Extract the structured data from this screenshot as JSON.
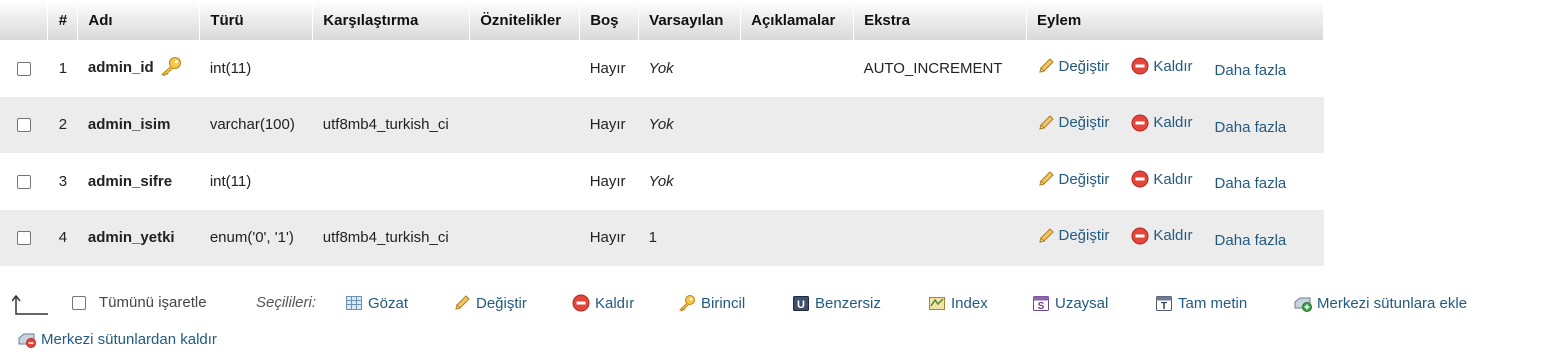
{
  "table": {
    "headers": {
      "num": "#",
      "name": "Adı",
      "type": "Türü",
      "collation": "Karşılaştırma",
      "attributes": "Öznitelikler",
      "null": "Boş",
      "default": "Varsayılan",
      "comments": "Açıklamalar",
      "extra": "Ekstra",
      "action": "Eylem"
    },
    "rows": [
      {
        "num": "1",
        "name": "admin_id",
        "type": "int(11)",
        "collation": "",
        "attributes": "",
        "null": "Hayır",
        "default": "Yok",
        "comments": "",
        "extra": "AUTO_INCREMENT",
        "primary_key": true
      },
      {
        "num": "2",
        "name": "admin_isim",
        "type": "varchar(100)",
        "collation": "utf8mb4_turkish_ci",
        "attributes": "",
        "null": "Hayır",
        "default": "Yok",
        "comments": "",
        "extra": ""
      },
      {
        "num": "3",
        "name": "admin_sifre",
        "type": "int(11)",
        "collation": "",
        "attributes": "",
        "null": "Hayır",
        "default": "Yok",
        "comments": "",
        "extra": ""
      },
      {
        "num": "4",
        "name": "admin_yetki",
        "type": "enum('0', '1')",
        "collation": "utf8mb4_turkish_ci",
        "attributes": "",
        "null": "Hayır",
        "default": "1",
        "comments": "",
        "extra": ""
      }
    ],
    "row_actions": {
      "change": "Değiştir",
      "drop": "Kaldır",
      "more": "Daha fazla"
    }
  },
  "bulk": {
    "check_all": "Tümünü işaretle",
    "with_selected": "Seçilileri:",
    "browse": "Gözat",
    "change": "Değiştir",
    "drop": "Kaldır",
    "primary": "Birincil",
    "unique": "Benzersiz",
    "index": "Index",
    "spatial": "Uzaysal",
    "fulltext": "Tam metin",
    "add_central": "Merkezi sütunlara ekle",
    "remove_central": "Merkezi sütunlardan kaldır"
  },
  "colors": {
    "link": "#235a81",
    "row_even": "#ececec",
    "drop_red": "#e5463c",
    "pencil": "#d9a43b"
  }
}
